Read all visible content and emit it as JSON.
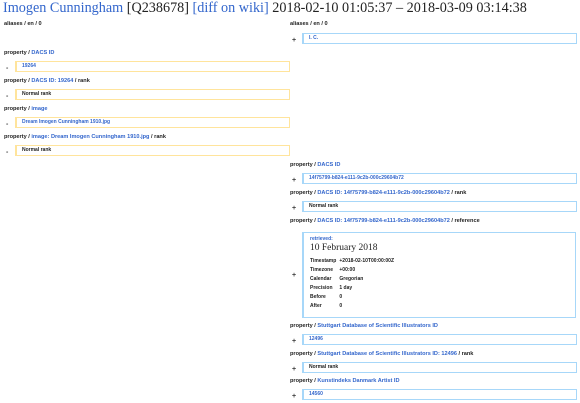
{
  "header": {
    "label": "Imogen Cunningham",
    "qid": "[Q238678]",
    "diff_link": "[diff on wiki]",
    "date_range": "2018-02-10  01:05:37 – 2018-03-09  03:14:38"
  },
  "left": {
    "aliases_heading": "aliases / en / 0",
    "blocks": [
      {
        "heading_prefix": "property / ",
        "heading_link": "DACS ID",
        "heading_suffix": "",
        "sign": "-",
        "value": "19264",
        "value_is_link": true
      },
      {
        "heading_prefix": "property / ",
        "heading_link": "DACS ID: 19264",
        "heading_suffix": " / rank",
        "sign": "-",
        "value": "Normal rank",
        "value_is_link": false
      },
      {
        "heading_prefix": "property / ",
        "heading_link": "image",
        "heading_suffix": "",
        "sign": "-",
        "value": "Dream Imogen Cunningham 1910.jpg",
        "value_is_link": true
      },
      {
        "heading_prefix": "property / ",
        "heading_link": "image: Dream Imogen Cunningham 1910.jpg",
        "heading_suffix": " / rank",
        "sign": "-",
        "value": "Normal rank",
        "value_is_link": false
      }
    ]
  },
  "right": {
    "aliases_heading": "aliases / en / 0",
    "alias_sign": "+",
    "alias_value": "I. C.",
    "blocks": [
      {
        "heading_prefix": "property / ",
        "heading_link": "DACS ID",
        "heading_suffix": "",
        "sign": "+",
        "value": "14f75799-b824-e111-9c2b-000c29604b72",
        "value_is_link": true
      },
      {
        "heading_prefix": "property / ",
        "heading_link": "DACS ID: 14f75799-b824-e111-9c2b-000c29604b72",
        "heading_suffix": " / rank",
        "sign": "+",
        "value": "Normal rank",
        "value_is_link": false
      },
      {
        "heading_prefix": "property / ",
        "heading_link": "DACS ID: 14f75799-b824-e111-9c2b-000c29604b72",
        "heading_suffix": " / reference",
        "sign": "+"
      }
    ],
    "reference": {
      "retrieved_label": "retrieved:",
      "date": "10 February 2018",
      "rows": [
        {
          "key": "Timestamp",
          "value": "+2018-02-10T00:00:00Z"
        },
        {
          "key": "Timezone",
          "value": "+00:00"
        },
        {
          "key": "Calendar",
          "value": "Gregorian"
        },
        {
          "key": "Precision",
          "value": "1 day"
        },
        {
          "key": "Before",
          "value": "0"
        },
        {
          "key": "After",
          "value": "0"
        }
      ]
    },
    "blocks2": [
      {
        "heading_prefix": "property / ",
        "heading_link": "Stuttgart Database of Scientific Illustrators ID",
        "heading_suffix": "",
        "sign": "+",
        "value": "12496",
        "value_is_link": true
      },
      {
        "heading_prefix": "property / ",
        "heading_link": "Stuttgart Database of Scientific Illustrators ID: 12496",
        "heading_suffix": " / rank",
        "sign": "+",
        "value": "Normal rank",
        "value_is_link": false
      },
      {
        "heading_prefix": "property / ",
        "heading_link": "Kunstindeks Danmark Artist ID",
        "heading_suffix": "",
        "sign": "+",
        "value": "14560",
        "value_is_link": true
      }
    ]
  }
}
